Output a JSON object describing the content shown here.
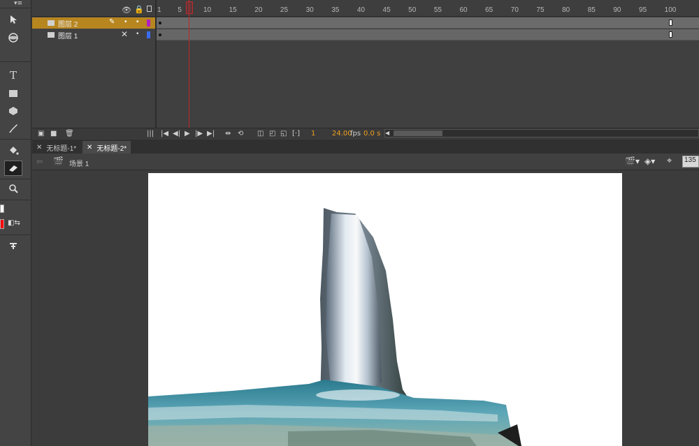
{
  "timeline": {
    "frame_numbers": [
      "1",
      "5",
      "10",
      "15",
      "20",
      "25",
      "30",
      "35",
      "40",
      "45",
      "50",
      "55",
      "60",
      "65",
      "70",
      "75",
      "80",
      "85",
      "90",
      "95",
      "100"
    ],
    "layers": [
      {
        "name": "图层 2",
        "selected": true,
        "color": "#b020c0"
      },
      {
        "name": "图层 1",
        "selected": false,
        "color": "#3a6cf0"
      }
    ],
    "footer": {
      "current_frame": "1",
      "fps": "24.00",
      "fps_unit": "fps",
      "time": "0.0 s"
    }
  },
  "tabs": [
    {
      "label": "无标题-1*",
      "active": false
    },
    {
      "label": "无标题-2*",
      "active": true
    }
  ],
  "editbar": {
    "scene": "场景 1",
    "zoom": "135"
  },
  "colors": {
    "selected_layer": "#b8861f",
    "playhead": "#c0282b",
    "frame_accent": "#f0a020",
    "stroke_color": "#ffffff",
    "fill_color": "#ff0000"
  },
  "icons": {
    "tools": [
      "selection-arrow-icon",
      "3d-rotation-icon",
      "text-tool-icon",
      "rectangle-tool-icon",
      "polystar-tool-icon",
      "brush-tool-icon",
      "paint-bucket-icon",
      "eraser-tool-icon",
      "zoom-tool-icon",
      "stroke-color-icon",
      "fill-color-icon",
      "swap-colors-icon",
      "snap-magnet-icon"
    ]
  }
}
